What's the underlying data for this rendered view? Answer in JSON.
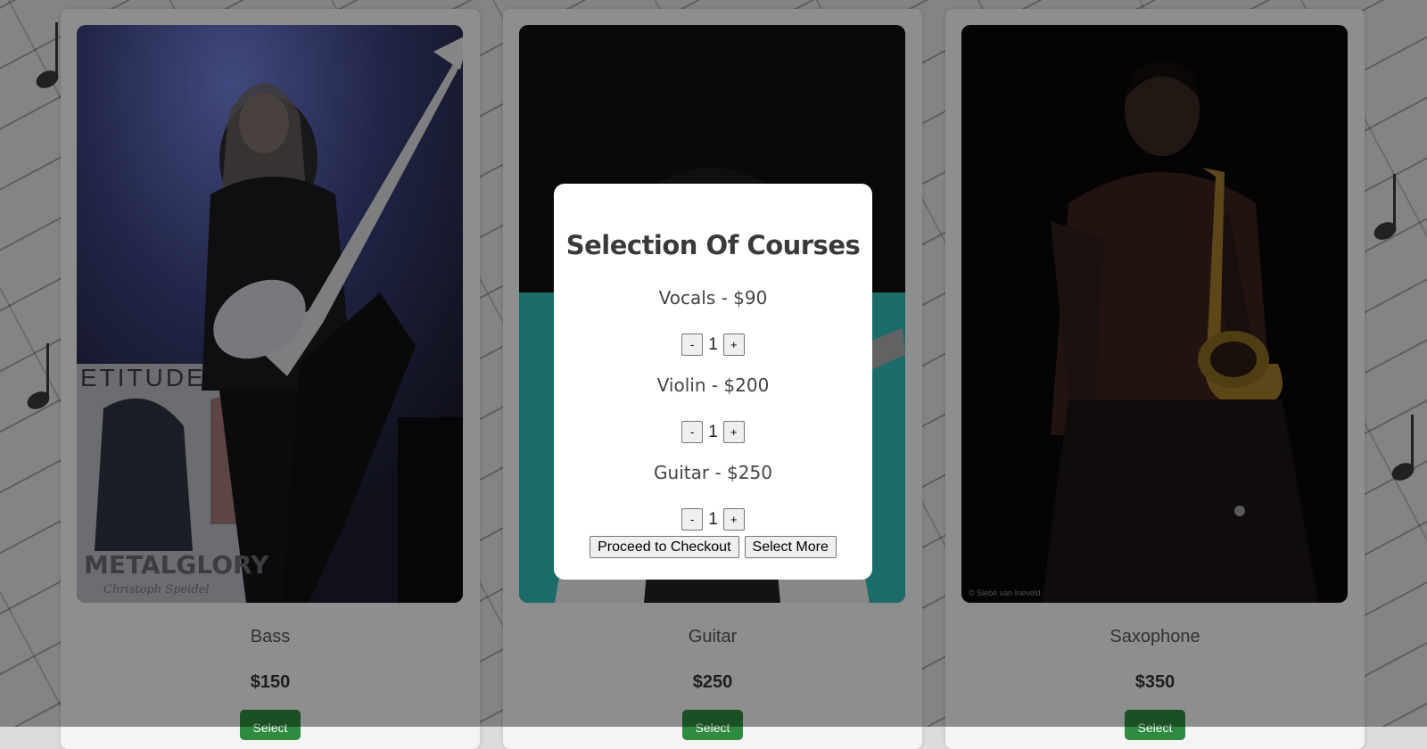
{
  "cards": [
    {
      "title": "Bass",
      "price": "$150",
      "button": "Select"
    },
    {
      "title": "Guitar",
      "price": "$250",
      "button": "Select"
    },
    {
      "title": "Saxophone",
      "price": "$350",
      "button": "Select"
    }
  ],
  "photo_captions": {
    "bass_banner": "ETITUDES + V",
    "bass_logo": "METALGLORY",
    "bass_credit": "Christoph Speidel",
    "sax_credit": "© Siebe van Ineveld"
  },
  "modal": {
    "title": "Selection Of Courses",
    "courses": [
      {
        "label": "Vocals - $90",
        "quantity": "1",
        "minus": "-",
        "plus": "+"
      },
      {
        "label": "Violin - $200",
        "quantity": "1",
        "minus": "-",
        "plus": "+"
      },
      {
        "label": "Guitar - $250",
        "quantity": "1",
        "minus": "-",
        "plus": "+"
      }
    ],
    "checkout_button": "Proceed to Checkout",
    "select_more_button": "Select More"
  }
}
